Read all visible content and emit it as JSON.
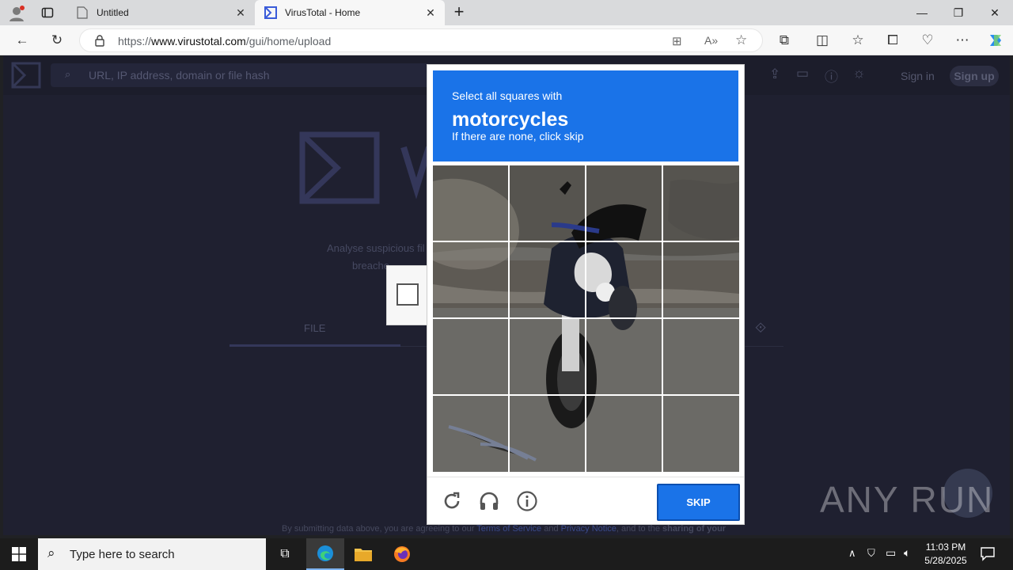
{
  "browser": {
    "tabs": [
      {
        "title": "Untitled",
        "active": false
      },
      {
        "title": "VirusTotal - Home",
        "active": true
      }
    ],
    "new_tab_label": "+",
    "url_prefix": "https://",
    "url_domain": "www.virustotal.com",
    "url_path": "/gui/home/upload"
  },
  "vt": {
    "search_placeholder": "URL, IP address, domain or file hash",
    "sign_in": "Sign in",
    "sign_up": "Sign up",
    "tagline_1": "Analyse suspicious fil",
    "tagline_2": "breache",
    "file_tab": "FILE",
    "footer_pre": "By submitting data above, you are agreeing to our ",
    "footer_terms": "Terms of Service",
    "footer_and": " and ",
    "footer_privacy": "Privacy Notice",
    "footer_post": ", and to the ",
    "footer_sharing": "sharing of your"
  },
  "captcha": {
    "line1": "Select all squares with",
    "target": "motorcycles",
    "line3": "If there are none, click skip",
    "skip_label": "SKIP",
    "brand_color": "#1a73e8"
  },
  "watermark": "ANY RUN",
  "taskbar": {
    "search_placeholder": "Type here to search",
    "time": "11:03 PM",
    "date": "5/28/2025"
  }
}
